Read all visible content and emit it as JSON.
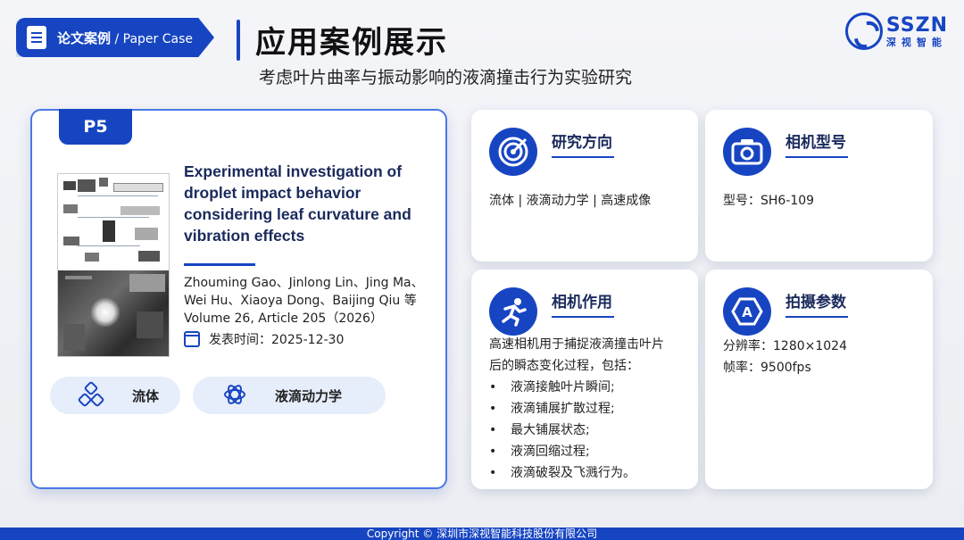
{
  "header": {
    "badge_cn": "论文案例",
    "badge_en": " / Paper Case",
    "title": "应用案例展示",
    "subtitle": "考虑叶片曲率与振动影响的液滴撞击行为实验研究"
  },
  "logo": {
    "text_en": "SSZN",
    "text_cn": "深视智能"
  },
  "paper": {
    "tag": "P5",
    "title": "Experimental investigation of droplet impact behavior considering leaf curvature and vibration effects",
    "authors_line1": "Zhouming Gao、Jinlong Lin、Jing Ma、",
    "authors_line2": "Wei Hu、Xiaoya Dong、Baijing Qiu 等",
    "volume": "Volume 26, Article 205（2026）",
    "date_label": "发表时间：2025-12-30",
    "tags": [
      "流体",
      "液滴动力学"
    ]
  },
  "cards": {
    "research": {
      "title": "研究方向",
      "body": "流体 | 液滴动力学 | 高速成像",
      "icon": "target-icon"
    },
    "camera": {
      "title": "相机型号",
      "body": "型号：SH6-109",
      "icon": "camera-icon"
    },
    "usage": {
      "title": "相机作用",
      "intro1": "高速相机用于捕捉液滴撞击叶片",
      "intro2": "后的瞬态变化过程，包括：",
      "items": [
        "液滴接触叶片瞬间;",
        "液滴铺展扩散过程;",
        "最大铺展状态;",
        "液滴回缩过程;",
        "液滴破裂及飞溅行为。"
      ],
      "icon": "runner-icon"
    },
    "params": {
      "title": "拍摄参数",
      "line1": "分辨率：1280×1024",
      "line2": "帧率：9500fps",
      "icon": "aperture-icon"
    }
  },
  "footer": {
    "text": "Copyright © 深圳市深视智能科技股份有限公司"
  },
  "colors": {
    "accent": "#1745c2",
    "title": "#1a2a5c",
    "pill": "#e6edfb"
  }
}
